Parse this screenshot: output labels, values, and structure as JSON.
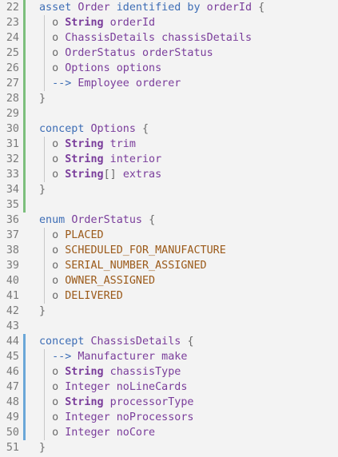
{
  "colors": {
    "background": "#f3f3f3",
    "line_number": "#7a7a7a",
    "keyword": "#3d6db5",
    "identifier": "#7a3d9b",
    "enum_value": "#9b5a1a",
    "punct": "#6a6a6a",
    "gutter_added": "#7cbf7c",
    "gutter_modified": "#6aa7d8"
  },
  "editor": {
    "lines": [
      {
        "n": "22",
        "gutter": "added",
        "guide": false,
        "tokens": [
          {
            "t": "asset ",
            "c": "kw"
          },
          {
            "t": "Order ",
            "c": "pl"
          },
          {
            "t": "identified by ",
            "c": "kw"
          },
          {
            "t": "orderId ",
            "c": "pl"
          },
          {
            "t": "{",
            "c": "pn"
          }
        ]
      },
      {
        "n": "23",
        "gutter": "added",
        "guide": true,
        "tokens": [
          {
            "t": "  o ",
            "c": "pn"
          },
          {
            "t": "String",
            "c": "tp"
          },
          {
            "t": " orderId",
            "c": "pl"
          }
        ]
      },
      {
        "n": "24",
        "gutter": "added",
        "guide": true,
        "tokens": [
          {
            "t": "  o ",
            "c": "pn"
          },
          {
            "t": "ChassisDetails chassisDetails",
            "c": "pl"
          }
        ]
      },
      {
        "n": "25",
        "gutter": "added",
        "guide": true,
        "tokens": [
          {
            "t": "  o ",
            "c": "pn"
          },
          {
            "t": "OrderStatus orderStatus",
            "c": "pl"
          }
        ]
      },
      {
        "n": "26",
        "gutter": "added",
        "guide": true,
        "tokens": [
          {
            "t": "  o ",
            "c": "pn"
          },
          {
            "t": "Options options",
            "c": "pl"
          }
        ]
      },
      {
        "n": "27",
        "gutter": "added",
        "guide": true,
        "tokens": [
          {
            "t": "  --> ",
            "c": "kw"
          },
          {
            "t": "Employee orderer",
            "c": "pl"
          }
        ]
      },
      {
        "n": "28",
        "gutter": "added",
        "guide": false,
        "tokens": [
          {
            "t": "}",
            "c": "pn"
          }
        ]
      },
      {
        "n": "29",
        "gutter": "added",
        "guide": false,
        "tokens": []
      },
      {
        "n": "30",
        "gutter": "added",
        "guide": false,
        "tokens": [
          {
            "t": "concept ",
            "c": "kw"
          },
          {
            "t": "Options ",
            "c": "pl"
          },
          {
            "t": "{",
            "c": "pn"
          }
        ]
      },
      {
        "n": "31",
        "gutter": "added",
        "guide": true,
        "tokens": [
          {
            "t": "  o ",
            "c": "pn"
          },
          {
            "t": "String",
            "c": "tp"
          },
          {
            "t": " trim",
            "c": "pl"
          }
        ]
      },
      {
        "n": "32",
        "gutter": "added",
        "guide": true,
        "tokens": [
          {
            "t": "  o ",
            "c": "pn"
          },
          {
            "t": "String",
            "c": "tp"
          },
          {
            "t": " interior",
            "c": "pl"
          }
        ]
      },
      {
        "n": "33",
        "gutter": "added",
        "guide": true,
        "tokens": [
          {
            "t": "  o ",
            "c": "pn"
          },
          {
            "t": "String",
            "c": "tp"
          },
          {
            "t": "[] ",
            "c": "pn"
          },
          {
            "t": "extras",
            "c": "pl"
          }
        ]
      },
      {
        "n": "34",
        "gutter": "added",
        "guide": false,
        "tokens": [
          {
            "t": "}",
            "c": "pn"
          }
        ]
      },
      {
        "n": "35",
        "gutter": "added",
        "guide": false,
        "tokens": []
      },
      {
        "n": "36",
        "gutter": "none",
        "guide": false,
        "tokens": [
          {
            "t": "enum ",
            "c": "kw"
          },
          {
            "t": "OrderStatus ",
            "c": "pl"
          },
          {
            "t": "{",
            "c": "pn"
          }
        ]
      },
      {
        "n": "37",
        "gutter": "none",
        "guide": true,
        "tokens": [
          {
            "t": "  o ",
            "c": "pn"
          },
          {
            "t": "PLACED",
            "c": "en"
          }
        ]
      },
      {
        "n": "38",
        "gutter": "none",
        "guide": true,
        "tokens": [
          {
            "t": "  o ",
            "c": "pn"
          },
          {
            "t": "SCHEDULED_FOR_MANUFACTURE",
            "c": "en"
          }
        ]
      },
      {
        "n": "39",
        "gutter": "none",
        "guide": true,
        "tokens": [
          {
            "t": "  o ",
            "c": "pn"
          },
          {
            "t": "SERIAL_NUMBER_ASSIGNED",
            "c": "en"
          }
        ]
      },
      {
        "n": "40",
        "gutter": "none",
        "guide": true,
        "tokens": [
          {
            "t": "  o ",
            "c": "pn"
          },
          {
            "t": "OWNER_ASSIGNED",
            "c": "en"
          }
        ]
      },
      {
        "n": "41",
        "gutter": "none",
        "guide": true,
        "tokens": [
          {
            "t": "  o ",
            "c": "pn"
          },
          {
            "t": "DELIVERED",
            "c": "en"
          }
        ]
      },
      {
        "n": "42",
        "gutter": "none",
        "guide": false,
        "tokens": [
          {
            "t": "}",
            "c": "pn"
          }
        ]
      },
      {
        "n": "43",
        "gutter": "none",
        "guide": false,
        "tokens": []
      },
      {
        "n": "44",
        "gutter": "modified",
        "guide": false,
        "tokens": [
          {
            "t": "concept ",
            "c": "kw"
          },
          {
            "t": "ChassisDetails ",
            "c": "pl"
          },
          {
            "t": "{",
            "c": "pn"
          }
        ]
      },
      {
        "n": "45",
        "gutter": "modified",
        "guide": true,
        "tokens": [
          {
            "t": "  --> ",
            "c": "kw"
          },
          {
            "t": "Manufacturer make",
            "c": "pl"
          }
        ]
      },
      {
        "n": "46",
        "gutter": "modified",
        "guide": true,
        "tokens": [
          {
            "t": "  o ",
            "c": "pn"
          },
          {
            "t": "String",
            "c": "tp"
          },
          {
            "t": " chassisType",
            "c": "pl"
          }
        ]
      },
      {
        "n": "47",
        "gutter": "modified",
        "guide": true,
        "tokens": [
          {
            "t": "  o ",
            "c": "pn"
          },
          {
            "t": "Integer noLineCards",
            "c": "pl"
          }
        ]
      },
      {
        "n": "48",
        "gutter": "modified",
        "guide": true,
        "tokens": [
          {
            "t": "  o ",
            "c": "pn"
          },
          {
            "t": "String",
            "c": "tp"
          },
          {
            "t": " processorType",
            "c": "pl"
          }
        ]
      },
      {
        "n": "49",
        "gutter": "modified",
        "guide": true,
        "tokens": [
          {
            "t": "  o ",
            "c": "pn"
          },
          {
            "t": "Integer noProcessors",
            "c": "pl"
          }
        ]
      },
      {
        "n": "50",
        "gutter": "modified",
        "guide": true,
        "tokens": [
          {
            "t": "  o ",
            "c": "pn"
          },
          {
            "t": "Integer noCore",
            "c": "pl"
          }
        ]
      },
      {
        "n": "51",
        "gutter": "none",
        "guide": false,
        "tokens": [
          {
            "t": "}",
            "c": "pn"
          }
        ]
      }
    ]
  }
}
